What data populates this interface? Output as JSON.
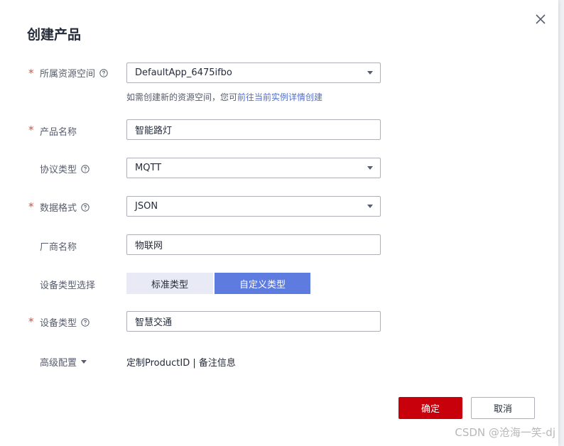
{
  "dialog": {
    "title": "创建产品",
    "close_icon": "close-icon"
  },
  "form": {
    "resource_space": {
      "label": "所属资源空间",
      "required": true,
      "value": "DefaultApp_6475ifbo",
      "hint_text": "如需创建新的资源空间，您可",
      "hint_link": "前往当前实例详情创建"
    },
    "product_name": {
      "label": "产品名称",
      "required": true,
      "value": "智能路灯"
    },
    "protocol": {
      "label": "协议类型",
      "required": false,
      "value": "MQTT"
    },
    "data_format": {
      "label": "数据格式",
      "required": true,
      "value": "JSON"
    },
    "vendor": {
      "label": "厂商名称",
      "required": false,
      "value": "物联网"
    },
    "device_type_select": {
      "label": "设备类型选择",
      "options": [
        "标准类型",
        "自定义类型"
      ],
      "selected": "自定义类型"
    },
    "device_type": {
      "label": "设备类型",
      "required": true,
      "value": "智慧交通"
    },
    "advanced": {
      "label": "高级配置",
      "links": "定制ProductID | 备注信息"
    }
  },
  "footer": {
    "ok_label": "确定",
    "cancel_label": "取消"
  },
  "colors": {
    "primary": "#c7000b",
    "accent": "#5e7ce0",
    "link": "#526ecc",
    "required": "#e8483a"
  },
  "watermark": "CSDN @沧海一笑-dj"
}
